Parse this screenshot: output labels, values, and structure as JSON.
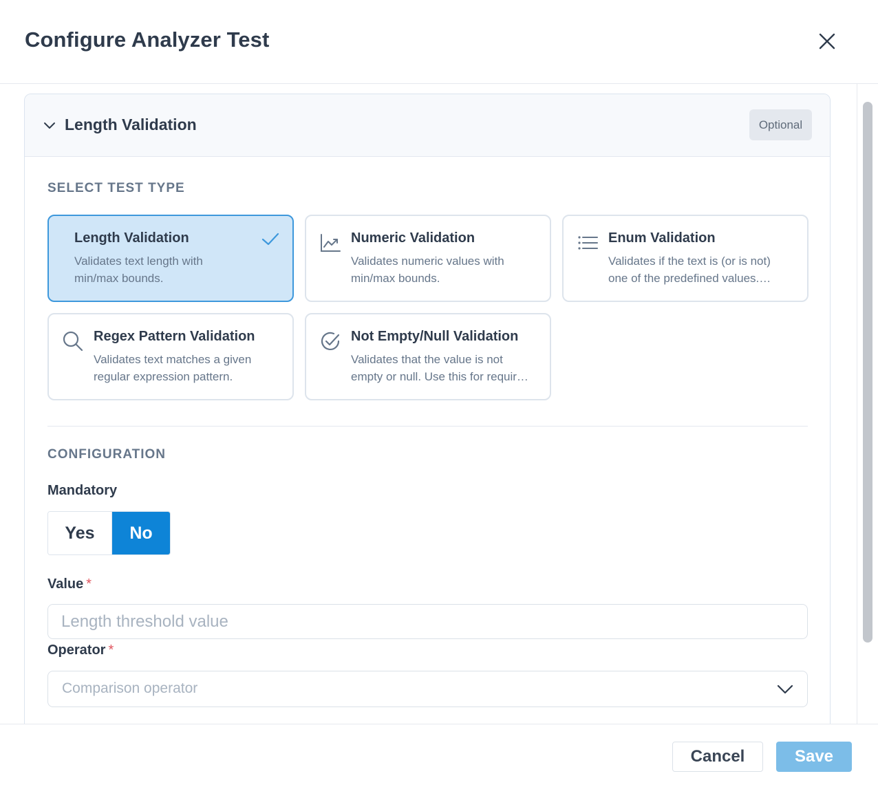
{
  "dialog": {
    "title": "Configure Analyzer Test",
    "close_icon": "close-icon"
  },
  "panel": {
    "title": "Length Validation",
    "badge": "Optional",
    "expanded": true
  },
  "test_type": {
    "section_label": "SELECT TEST TYPE",
    "selected": "Length Validation",
    "cards": [
      {
        "title": "Length Validation",
        "desc_line1": "Validates text length with",
        "desc_line2": "min/max bounds.",
        "icon": "none",
        "selected": true
      },
      {
        "title": "Numeric Validation",
        "desc_line1": "Validates numeric values with",
        "desc_line2": "min/max bounds.",
        "icon": "chart-trend-icon",
        "selected": false
      },
      {
        "title": "Enum Validation",
        "desc_line1": "Validates if the text is (or is not)",
        "desc_line2": "one of the predefined values.…",
        "icon": "list-icon",
        "selected": false
      },
      {
        "title": "Regex Pattern Validation",
        "desc_line1": "Validates text matches a given",
        "desc_line2": "regular expression pattern.",
        "icon": "search-icon",
        "selected": false
      },
      {
        "title": "Not Empty/Null Validation",
        "desc_line1": "Validates that the value is not",
        "desc_line2": "empty or null. Use this for requir…",
        "icon": "check-circle-icon",
        "selected": false
      }
    ]
  },
  "configuration": {
    "section_label": "CONFIGURATION",
    "mandatory": {
      "label": "Mandatory",
      "yes_label": "Yes",
      "no_label": "No",
      "selected": "No"
    },
    "value": {
      "label": "Value",
      "required_mark": "*",
      "placeholder": "Length threshold value",
      "current_value": ""
    },
    "operator": {
      "label": "Operator",
      "required_mark": "*",
      "placeholder": "Comparison operator",
      "selected_value": ""
    }
  },
  "footer": {
    "cancel_label": "Cancel",
    "save_label": "Save"
  },
  "colors": {
    "accent": "#0e84d7",
    "selected_card_bg": "#d0e6f8",
    "selected_card_border": "#3d98dc",
    "save_disabled": "#7cbde8",
    "required": "#e0565f"
  }
}
